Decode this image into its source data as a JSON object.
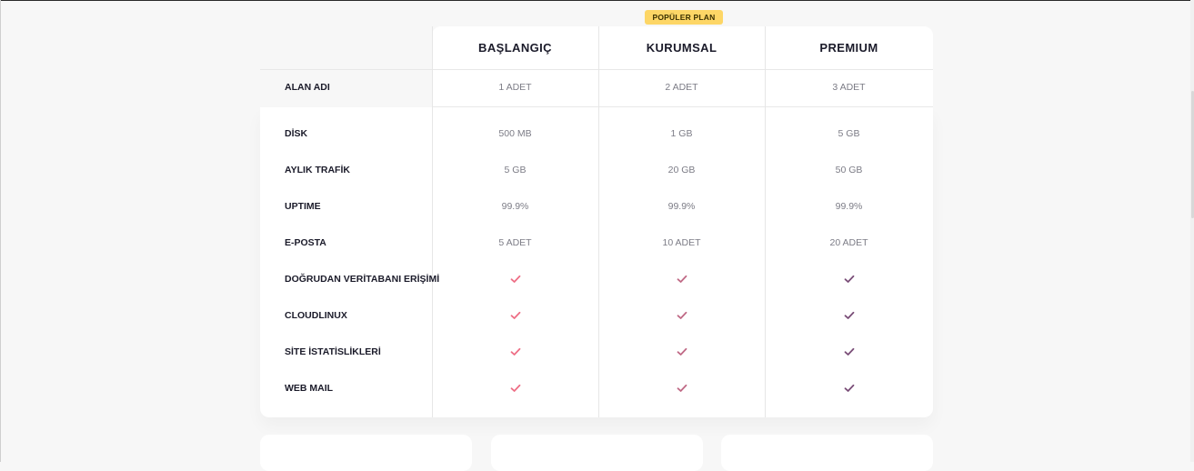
{
  "badge": {
    "popular": "POPÜLER PLAN"
  },
  "plans": [
    {
      "name": "BAŞLANGIÇ",
      "check_color": "#ee6f86"
    },
    {
      "name": "KURUMSAL",
      "check_color": "#c06a86"
    },
    {
      "name": "PREMIUM",
      "check_color": "#7a4e78"
    }
  ],
  "rows": [
    {
      "label": "ALAN ADI",
      "values": [
        "1 ADET",
        "2 ADET",
        "3 ADET"
      ]
    },
    {
      "label": "DİSK",
      "values": [
        "500 MB",
        "1 GB",
        "5 GB"
      ]
    },
    {
      "label": "AYLIK TRAFİK",
      "values": [
        "5 GB",
        "20 GB",
        "50 GB"
      ]
    },
    {
      "label": "UPTIME",
      "values": [
        "99.9%",
        "99.9%",
        "99.9%"
      ]
    },
    {
      "label": "E-POSTA",
      "values": [
        "5 ADET",
        "10 ADET",
        "20 ADET"
      ]
    },
    {
      "label": "DOĞRUDAN VERİTABANI ERİŞİMİ",
      "check": true
    },
    {
      "label": "CLOUDLINUX",
      "check": true
    },
    {
      "label": "SİTE İSTATİSLİKLERİ",
      "check": true
    },
    {
      "label": "WEB MAIL",
      "check": true
    }
  ],
  "icons": {
    "check": "check-icon"
  }
}
